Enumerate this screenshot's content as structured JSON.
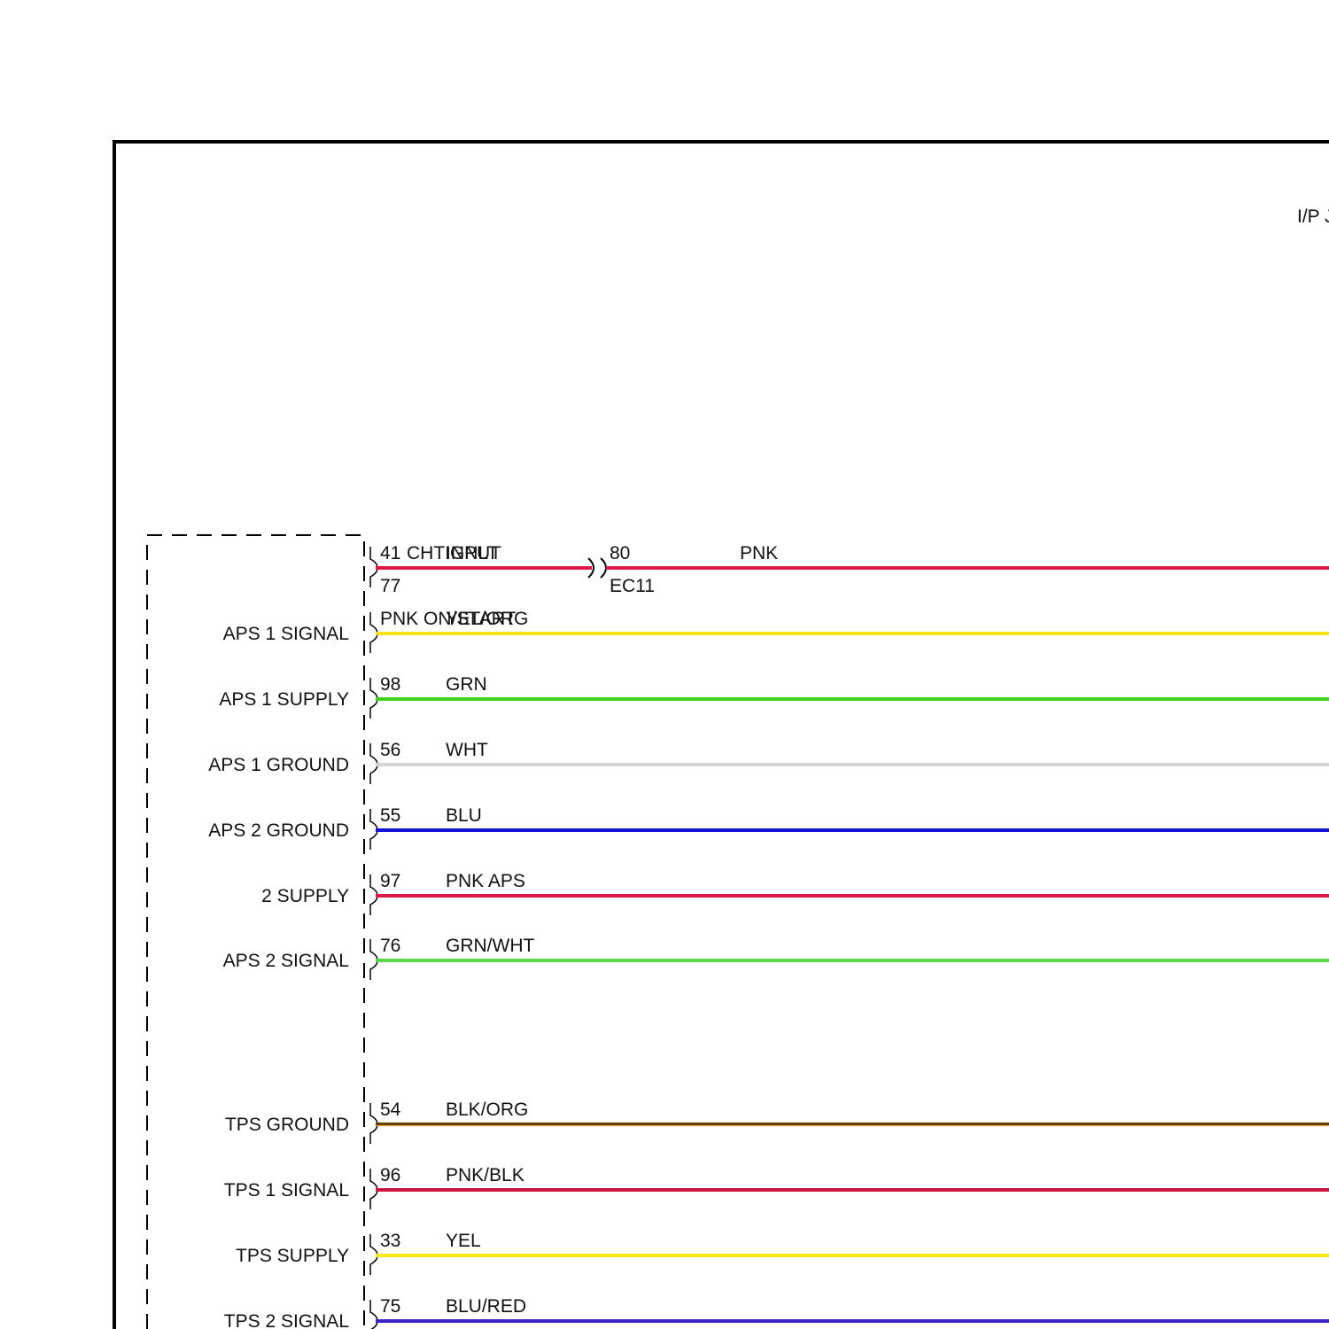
{
  "header": {
    "partial_label": "I/P J"
  },
  "connector": {
    "name": "EC11",
    "pin": "80",
    "wire_color": "PNK"
  },
  "wires": [
    {
      "id": "w0",
      "signal": "",
      "pin": "41",
      "wire_label": "CHTIGNLT",
      "wire_color_name": "PNK",
      "color": "#e0184a",
      "below_pin": "77",
      "below_text": "PNK ON/START",
      "overlay_label": "INPUT"
    },
    {
      "id": "w1",
      "signal": "APS 1 SIGNAL",
      "pin": "",
      "wire_label": "YEL/ORG",
      "color": "#f6e21a"
    },
    {
      "id": "w2",
      "signal": "APS 1 SUPPLY",
      "pin": "98",
      "wire_label": "GRN",
      "color": "#3fd21e"
    },
    {
      "id": "w3",
      "signal": "APS 1 GROUND",
      "pin": "56",
      "wire_label": "WHT",
      "color": "#d4d4d4"
    },
    {
      "id": "w4",
      "signal": "APS 2 GROUND",
      "pin": "55",
      "wire_label": "BLU",
      "color": "#1010d6"
    },
    {
      "id": "w5",
      "signal": "2 SUPPLY",
      "pin": "97",
      "wire_label": "PNK APS",
      "color": "#e0184a"
    },
    {
      "id": "w6",
      "signal": "APS 2 SIGNAL",
      "pin": "76",
      "wire_label": "GRN/WHT",
      "color": "#5ad84a"
    },
    {
      "id": "w7",
      "signal": "TPS GROUND",
      "pin": "54",
      "wire_label": "BLK/ORG",
      "color": "#5a3a0c",
      "accent": "#f0a020"
    },
    {
      "id": "w8",
      "signal": "TPS 1 SIGNAL",
      "pin": "96",
      "wire_label": "PNK/BLK",
      "color": "#c8183e"
    },
    {
      "id": "w9",
      "signal": "TPS SUPPLY",
      "pin": "33",
      "wire_label": "YEL",
      "color": "#f8ec1a"
    },
    {
      "id": "w10",
      "signal": "TPS 2 SIGNAL",
      "pin": "75",
      "wire_label": "BLU/RED",
      "color": "#3a20c8"
    }
  ]
}
